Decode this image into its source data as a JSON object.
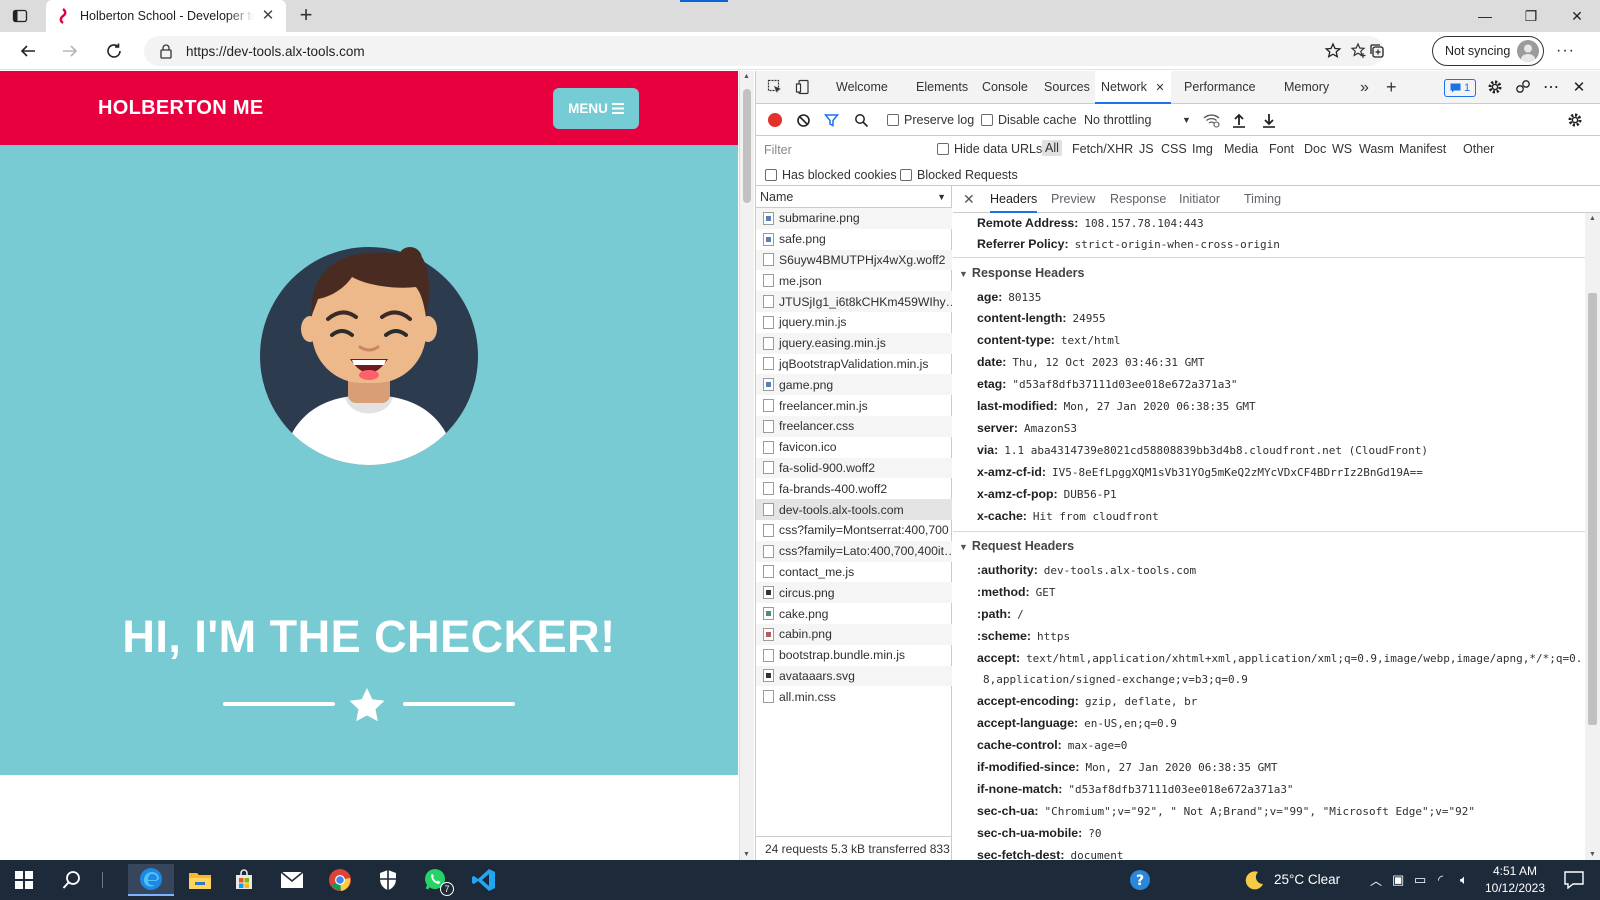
{
  "browser": {
    "tab_title": "Holberton School - Developer to",
    "url": "https://dev-tools.alx-tools.com",
    "sync_label": "Not syncing"
  },
  "page": {
    "brand": "HOLBERTON ME",
    "menu_label": "MENU",
    "headline": "HI, I'M THE CHECKER!",
    "colors": {
      "nav": "#e8003e",
      "masthead": "#78cbd3",
      "menu_button": "#75ccd4"
    }
  },
  "devtools": {
    "tabs": [
      "Welcome",
      "Elements",
      "Console",
      "Sources",
      "Network",
      "Performance",
      "Memory"
    ],
    "active_tab": "Network",
    "issues_count": "1",
    "toolbar": {
      "preserve_log": "Preserve log",
      "disable_cache": "Disable cache",
      "throttling": "No throttling"
    },
    "filter": {
      "placeholder": "Filter",
      "hide_data_urls": "Hide data URLs",
      "types": [
        "All",
        "Fetch/XHR",
        "JS",
        "CSS",
        "Img",
        "Media",
        "Font",
        "Doc",
        "WS",
        "Wasm",
        "Manifest",
        "Other"
      ],
      "has_blocked_cookies": "Has blocked cookies",
      "blocked_requests": "Blocked Requests"
    },
    "name_header": "Name",
    "requests": [
      "submarine.png",
      "safe.png",
      "S6uyw4BMUTPHjx4wXg.woff2",
      "me.json",
      "JTUSjIg1_i6t8kCHKm459WIhy…",
      "jquery.min.js",
      "jquery.easing.min.js",
      "jqBootstrapValidation.min.js",
      "game.png",
      "freelancer.min.js",
      "freelancer.css",
      "favicon.ico",
      "fa-solid-900.woff2",
      "fa-brands-400.woff2",
      "dev-tools.alx-tools.com",
      "css?family=Montserrat:400,700",
      "css?family=Lato:400,700,400it…",
      "contact_me.js",
      "circus.png",
      "cake.png",
      "cabin.png",
      "bootstrap.bundle.min.js",
      "avataaars.svg",
      "all.min.css"
    ],
    "status_bar": "24 requests  5.3 kB transferred  833",
    "detail_tabs": [
      "Headers",
      "Preview",
      "Response",
      "Initiator",
      "Timing"
    ],
    "general": [
      {
        "k": "Remote Address:",
        "v": "108.157.78.104:443"
      },
      {
        "k": "Referrer Policy:",
        "v": "strict-origin-when-cross-origin"
      }
    ],
    "response_headers_title": "Response Headers",
    "response_headers": [
      {
        "k": "age:",
        "v": "80135"
      },
      {
        "k": "content-length:",
        "v": "24955"
      },
      {
        "k": "content-type:",
        "v": "text/html"
      },
      {
        "k": "date:",
        "v": "Thu, 12 Oct 2023 03:46:31 GMT"
      },
      {
        "k": "etag:",
        "v": "\"d53af8dfb37111d03ee018e672a371a3\""
      },
      {
        "k": "last-modified:",
        "v": "Mon, 27 Jan 2020 06:38:35 GMT"
      },
      {
        "k": "server:",
        "v": "AmazonS3"
      },
      {
        "k": "via:",
        "v": "1.1 aba4314739e8021cd58808839bb3d4b8.cloudfront.net (CloudFront)"
      },
      {
        "k": "x-amz-cf-id:",
        "v": "IV5-8eEfLpggXQM1sVb31YOg5mKeQ2zMYcVDxCF4BDrrIz2BnGd19A=="
      },
      {
        "k": "x-amz-cf-pop:",
        "v": "DUB56-P1"
      },
      {
        "k": "x-cache:",
        "v": "Hit from cloudfront"
      }
    ],
    "request_headers_title": "Request Headers",
    "request_headers": [
      {
        "k": ":authority:",
        "v": "dev-tools.alx-tools.com"
      },
      {
        "k": ":method:",
        "v": "GET"
      },
      {
        "k": ":path:",
        "v": "/"
      },
      {
        "k": ":scheme:",
        "v": "https"
      },
      {
        "k": "accept:",
        "v": "text/html,application/xhtml+xml,application/xml;q=0.9,image/webp,image/apng,*/*;q=0."
      },
      {
        "k": "",
        "v": "8,application/signed-exchange;v=b3;q=0.9"
      },
      {
        "k": "accept-encoding:",
        "v": "gzip, deflate, br"
      },
      {
        "k": "accept-language:",
        "v": "en-US,en;q=0.9"
      },
      {
        "k": "cache-control:",
        "v": "max-age=0"
      },
      {
        "k": "if-modified-since:",
        "v": "Mon, 27 Jan 2020 06:38:35 GMT"
      },
      {
        "k": "if-none-match:",
        "v": "\"d53af8dfb37111d03ee018e672a371a3\""
      },
      {
        "k": "sec-ch-ua:",
        "v": "\"Chromium\";v=\"92\", \" Not A;Brand\";v=\"99\", \"Microsoft Edge\";v=\"92\""
      },
      {
        "k": "sec-ch-ua-mobile:",
        "v": "?0"
      },
      {
        "k": "sec-fetch-dest:",
        "v": "document"
      }
    ]
  },
  "taskbar": {
    "weather": "25°C  Clear",
    "time": "4:51 AM",
    "date": "10/12/2023",
    "whatsapp_badge": "7"
  }
}
